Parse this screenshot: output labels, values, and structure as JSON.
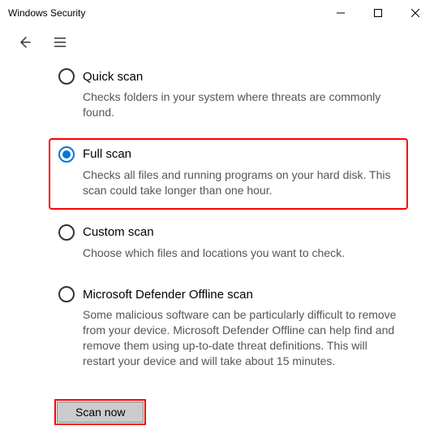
{
  "window": {
    "title": "Windows Security"
  },
  "options": {
    "quick": {
      "label": "Quick scan",
      "desc": "Checks folders in your system where threats are commonly found."
    },
    "full": {
      "label": "Full scan",
      "desc": "Checks all files and running programs on your hard disk. This scan could take longer than one hour."
    },
    "custom": {
      "label": "Custom scan",
      "desc": "Choose which files and locations you want to check."
    },
    "offline": {
      "label": "Microsoft Defender Offline scan",
      "desc": "Some malicious software can be particularly difficult to remove from your device. Microsoft Defender Offline can help find and remove them using up-to-date threat definitions. This will restart your device and will take about 15 minutes."
    }
  },
  "actions": {
    "scan_now": "Scan now"
  }
}
